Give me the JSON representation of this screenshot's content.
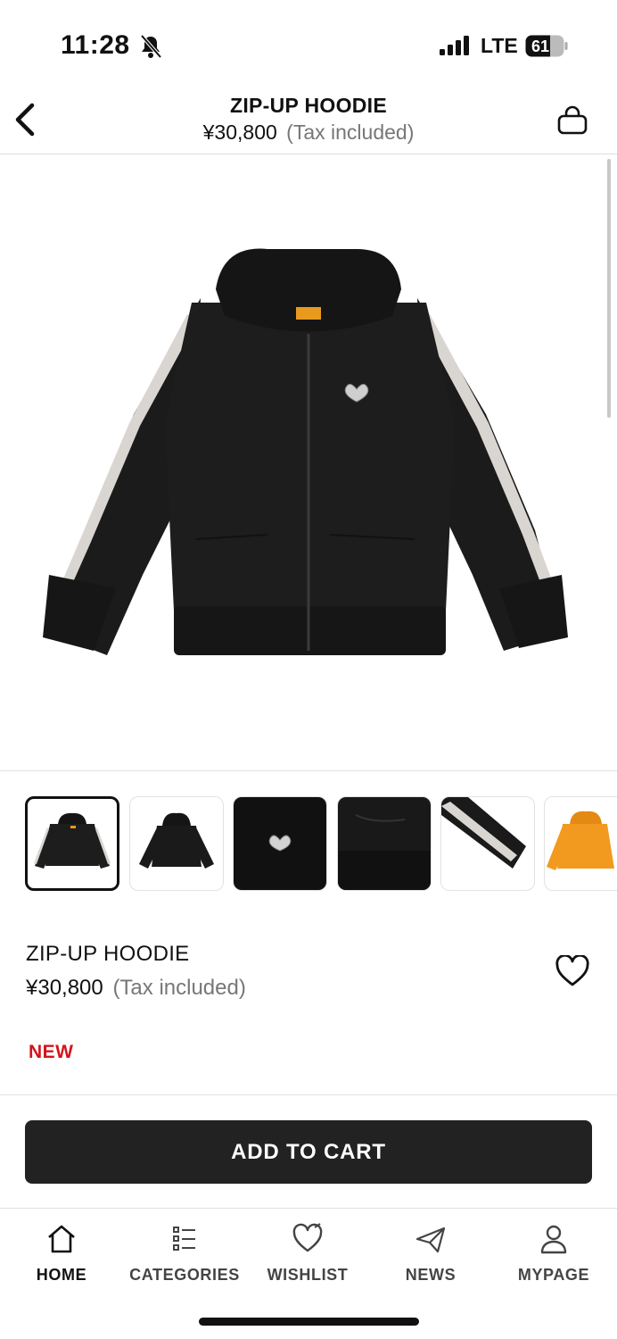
{
  "status_bar": {
    "time": "11:28",
    "network": "LTE",
    "battery": "61"
  },
  "header": {
    "title": "ZIP-UP HOODIE",
    "price": "¥30,800",
    "tax_note": "(Tax included)"
  },
  "gallery": {
    "thumbnails": [
      {
        "label": "hoodie-front",
        "selected": true
      },
      {
        "label": "hoodie-back",
        "selected": false
      },
      {
        "label": "heart-emblem-detail",
        "selected": false
      },
      {
        "label": "hem-detail",
        "selected": false
      },
      {
        "label": "sleeve-tape-detail",
        "selected": false
      },
      {
        "label": "orange-hoodie",
        "selected": false
      }
    ]
  },
  "product": {
    "name": "ZIP-UP HOODIE",
    "price": "¥30,800",
    "tax_note": "(Tax included)",
    "badge": "NEW",
    "badge_color": "#d4141b"
  },
  "actions": {
    "add_to_cart": "ADD TO CART"
  },
  "bottom_nav": {
    "items": [
      {
        "label": "HOME",
        "icon": "home-icon",
        "active": true
      },
      {
        "label": "CATEGORIES",
        "icon": "categories-icon",
        "active": false
      },
      {
        "label": "WISHLIST",
        "icon": "wishlist-heart-icon",
        "active": false
      },
      {
        "label": "NEWS",
        "icon": "paper-plane-icon",
        "active": false
      },
      {
        "label": "MYPAGE",
        "icon": "person-icon",
        "active": false
      }
    ]
  },
  "colors": {
    "button_bg": "#222222",
    "text_primary": "#111111",
    "text_muted": "#777777",
    "accent_new": "#d4141b"
  }
}
